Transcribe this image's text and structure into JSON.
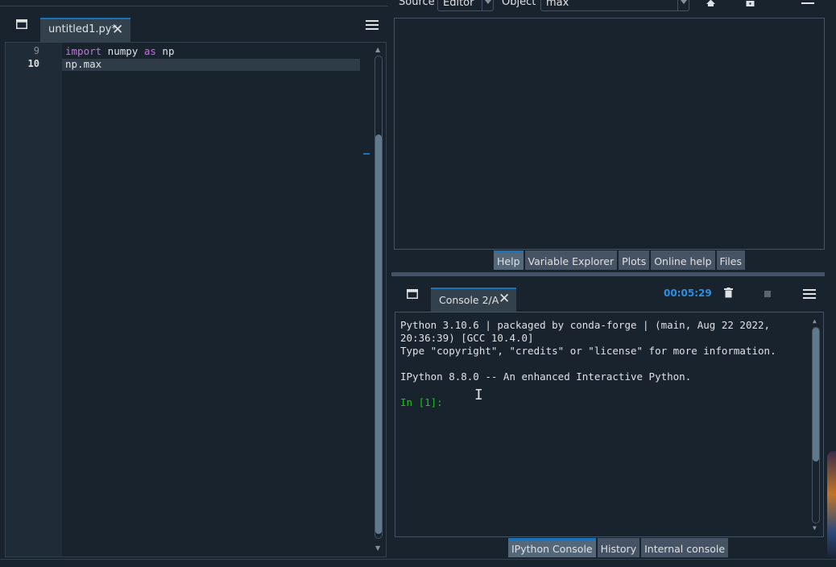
{
  "editor": {
    "tab_title": "untitled1.py*",
    "line_numbers": [
      "9",
      "10"
    ],
    "code": {
      "line9_kw_import": "import",
      "line9_mod": " numpy ",
      "line9_kw_as": "as",
      "line9_alias": " np",
      "line10": "np.max"
    }
  },
  "help": {
    "source_label": "Source",
    "source_value": "Editor",
    "object_label": "Object",
    "object_value": "max",
    "tabs": [
      "Help",
      "Variable Explorer",
      "Plots",
      "Online help",
      "Files"
    ]
  },
  "console": {
    "tab_title": "Console 2/A",
    "elapsed": "00:05:29",
    "lines": [
      "Python 3.10.6 | packaged by conda-forge | (main, Aug 22 2022,",
      "20:36:39) [GCC 10.4.0]",
      "Type \"copyright\", \"credits\" or \"license\" for more information.",
      "",
      "IPython 8.8.0 -- An enhanced Interactive Python."
    ],
    "prompt": "In [1]:",
    "tabs": [
      "IPython Console",
      "History",
      "Internal console"
    ]
  },
  "colors": {
    "background": "#19232d",
    "accent": "#1a72bb",
    "keyword": "#c670e0",
    "prompt": "#11cc11",
    "timer": "#2d8ee5"
  },
  "icons": [
    "undock-pane-icon",
    "close-icon",
    "options-menu-icon",
    "home-icon",
    "lock-icon",
    "remove-all-variables-icon",
    "stop-icon"
  ]
}
